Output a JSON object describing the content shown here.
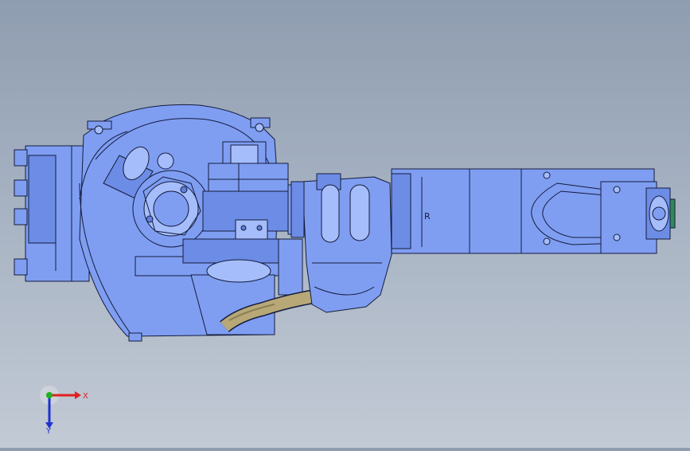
{
  "viewport": {
    "background_top": "#8f9db0",
    "background_bottom": "#c2cad5",
    "part_fill": "#7f9ef2",
    "part_fill_dark": "#5f7fd8",
    "part_fill_light": "#a6bdfb",
    "edge_color": "#141c3c",
    "cable_color": "#b8a878",
    "accent_green": "#2f8a5a"
  },
  "model": {
    "arm_marking_letter": "R"
  },
  "triad": {
    "x_label": "X",
    "y_label": "Y",
    "x_color": "#e02020",
    "y_color": "#2030d0",
    "origin_color": "#20b020"
  }
}
